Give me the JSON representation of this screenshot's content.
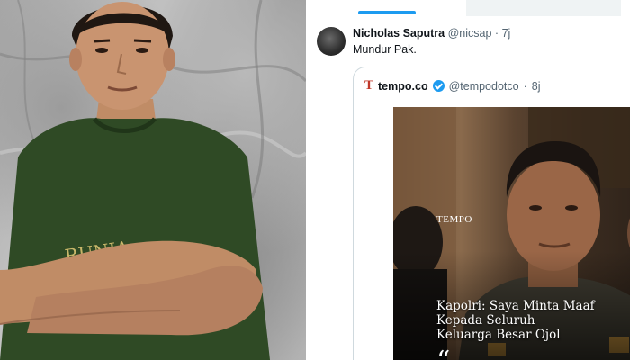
{
  "tweet": {
    "author_name": "Nicholas Saputra",
    "author_handle": "@nicsap",
    "time": "7j",
    "text": "Mundur Pak."
  },
  "quoted_tweet": {
    "author_name": "tempo.co",
    "author_handle": "@tempodotco",
    "time": "8j",
    "image": {
      "watermark": "TEMPO",
      "headline_lines": [
        "Kapolri: Saya Minta Maaf",
        "Kepada Seluruh",
        "Keluarga Besar Ojol"
      ],
      "quote_mark": "“"
    }
  },
  "colors": {
    "accent": "#1d9bf0",
    "text_primary": "#0f1419",
    "text_secondary": "#536471",
    "tempo_red": "#c0392b",
    "shirt_green": "#2f4a25"
  },
  "icons": [
    "verified-badge-icon",
    "tempo-logo-icon"
  ]
}
